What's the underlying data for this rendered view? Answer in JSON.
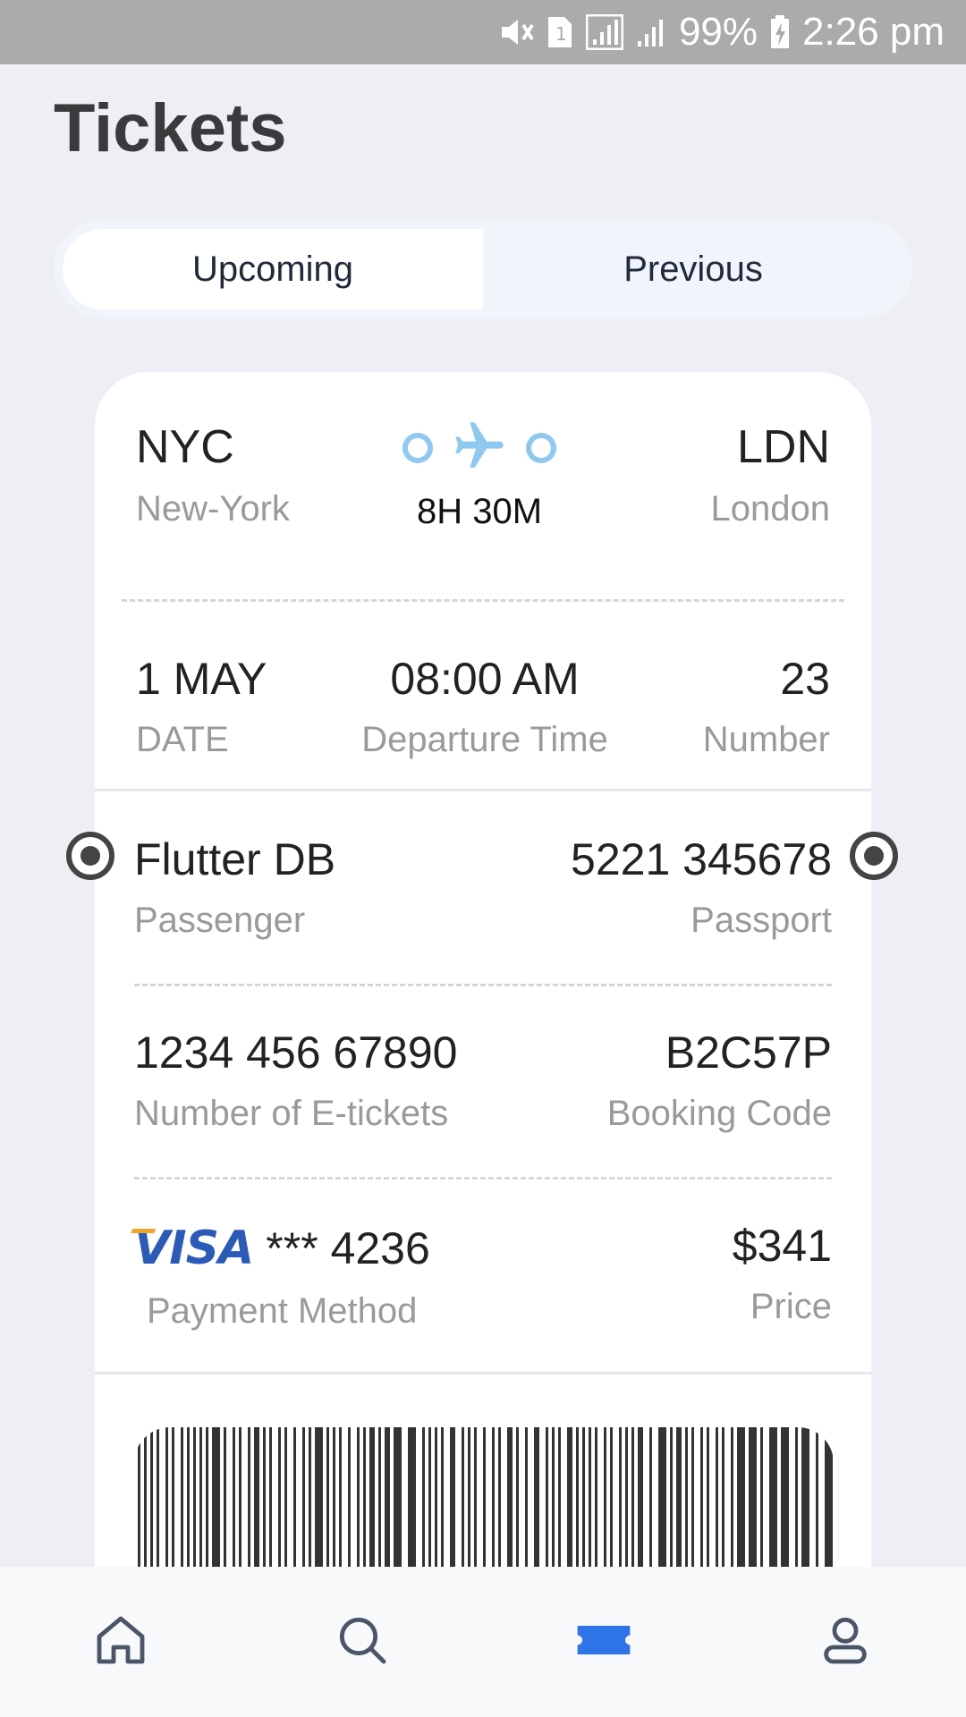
{
  "status_bar": {
    "battery": "99%",
    "time": "2:26 pm",
    "icons": [
      "mute-icon",
      "sim-icon",
      "signal-icon",
      "signal-icon",
      "battery-charging-icon"
    ]
  },
  "page": {
    "title": "Tickets"
  },
  "tabs": [
    {
      "label": "Upcoming",
      "active": true
    },
    {
      "label": "Previous",
      "active": false
    }
  ],
  "ticket": {
    "from": {
      "code": "NYC",
      "city": "New-York"
    },
    "to": {
      "code": "LDN",
      "city": "London"
    },
    "duration": "8H 30M",
    "date": {
      "value": "1 MAY",
      "label": "DATE"
    },
    "departure": {
      "value": "08:00 AM",
      "label": "Departure Time"
    },
    "number": {
      "value": "23",
      "label": "Number"
    },
    "passenger": {
      "value": "Flutter DB",
      "label": "Passenger"
    },
    "passport": {
      "value": "5221 345678",
      "label": "Passport"
    },
    "etickets": {
      "value": "1234 456 67890",
      "label": "Number of E-tickets"
    },
    "booking": {
      "value": "B2C57P",
      "label": "Booking Code"
    },
    "payment": {
      "brand": "VISA",
      "value": "*** 4236",
      "label": "Payment Method"
    },
    "price": {
      "value": "$341",
      "label": "Price"
    }
  },
  "nav": [
    {
      "icon": "home-icon",
      "active": false
    },
    {
      "icon": "search-icon",
      "active": false
    },
    {
      "icon": "ticket-icon",
      "active": true
    },
    {
      "icon": "profile-icon",
      "active": false
    }
  ],
  "colors": {
    "accent": "#2f74e6",
    "plane": "#8fc8f0",
    "nav_inactive": "#4a5568"
  }
}
